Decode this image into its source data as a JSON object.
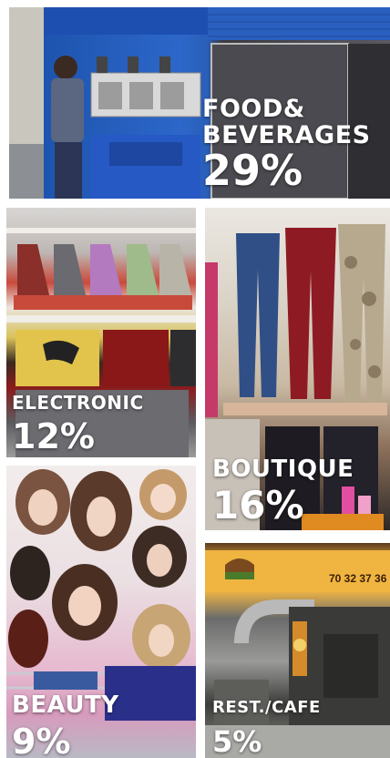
{
  "chart_data": {
    "type": "table",
    "categories": [
      "FOOD& BEVERAGES",
      "ELECTRONIC",
      "BOUTIQUE",
      "BEAUTY",
      "REST./CAFE"
    ],
    "values": [
      29,
      12,
      16,
      9,
      5
    ],
    "value_suffix": "%"
  },
  "tiles": {
    "food": {
      "label_line1": "FOOD&",
      "label_line2": "BEVERAGES",
      "pct": "29%"
    },
    "elec": {
      "label": "ELECTRONIC",
      "pct": "12%"
    },
    "bout": {
      "label": "BOUTIQUE",
      "pct": "16%"
    },
    "beau": {
      "label": "BEAUTY",
      "pct": "9%"
    },
    "rest": {
      "label": "REST./CAFE",
      "pct": "5%",
      "sign_number": "70 32 37 36"
    }
  }
}
